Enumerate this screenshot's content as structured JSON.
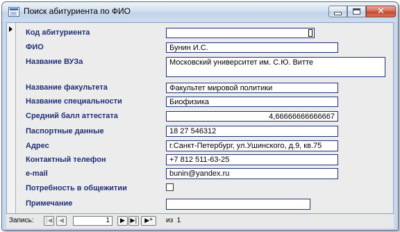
{
  "window": {
    "title": "Поиск абитуриента по ФИО"
  },
  "form": {
    "fields": [
      {
        "label": "Код абитуриента",
        "value": ""
      },
      {
        "label": "ФИО",
        "value": "Бунин И.С."
      },
      {
        "label": "Название ВУЗа",
        "value": "Московский университет им. С.Ю. Витте"
      },
      {
        "label": "Название факультета",
        "value": "Факультет мировой политики"
      },
      {
        "label": "Название специальности",
        "value": "Биофизика"
      },
      {
        "label": "Средний балл аттестата",
        "value": "4,66666666666667"
      },
      {
        "label": "Паспортные данные",
        "value": "18 27 546312"
      },
      {
        "label": "Адрес",
        "value": "г.Санкт-Петербург, ул.Ушинского, д.9, кв.75"
      },
      {
        "label": "Контактный телефон",
        "value": "+7 812 511-63-25"
      },
      {
        "label": "e-mail",
        "value": "bunin@yandex.ru"
      },
      {
        "label": "Потребность в общежитии",
        "checked": false
      },
      {
        "label": "Примечание",
        "value": ""
      }
    ]
  },
  "navigation": {
    "record_label": "Запись:",
    "current_record": "1",
    "of_label": "из",
    "total_records": "1"
  },
  "icons": {
    "first": "first-record-icon",
    "prev": "prev-record-icon",
    "next": "next-record-icon",
    "last": "last-record-icon",
    "new": "new-record-icon"
  }
}
